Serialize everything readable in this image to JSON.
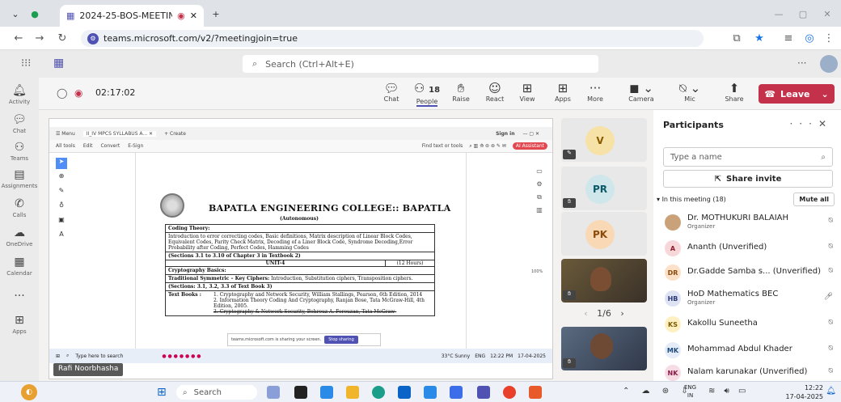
{
  "browser": {
    "tab_title": "2024-25-BOS-MEETING ON",
    "url": "teams.microsoft.com/v2/?meetingjoin=true"
  },
  "teams": {
    "search_placeholder": "Search (Ctrl+Alt+E)",
    "rail": [
      {
        "label": "Activity",
        "icon": "bell-icon"
      },
      {
        "label": "Chat",
        "icon": "chat-icon"
      },
      {
        "label": "Teams",
        "icon": "teams-icon"
      },
      {
        "label": "Assignments",
        "icon": "assignments-icon"
      },
      {
        "label": "Calls",
        "icon": "phone-icon"
      },
      {
        "label": "OneDrive",
        "icon": "cloud-icon"
      },
      {
        "label": "Calendar",
        "icon": "calendar-icon"
      },
      {
        "label": "Apps",
        "icon": "apps-icon"
      }
    ]
  },
  "meeting": {
    "timer": "02:17:02",
    "people_count": "18",
    "toolbar": [
      "Chat",
      "People",
      "Raise",
      "React",
      "View",
      "Apps",
      "More",
      "Camera",
      "Mic",
      "Share"
    ],
    "leave_label": "Leave",
    "presenter_name": "Rafi Noorbhasha",
    "pager": "1/6"
  },
  "shared_screen": {
    "tab_label": "II_IV MPCS SYLLABUS A...",
    "create_label": "+ Create",
    "pdf_menu": [
      "All tools",
      "Edit",
      "Convert",
      "E-Sign"
    ],
    "find_label": "Find text or tools",
    "sign_in": "Sign in",
    "ai_assistant": "AI Assistant",
    "college": "BAPATLA ENGINEERING COLLEGE:: BAPATLA",
    "autonomous": "(Autonomous)",
    "coding_theory": "Coding Theory:",
    "coding_text": "Introduction to error correcting codes, Basic definitions, Matrix description of Linear Block Codes, Equivalent Codes, Parity Check Matrix, Decoding of a Liner Block Code, Syndrome Decoding,Error Probability after Coding, Perfect Codes, Hamming Codes",
    "sections1": "(Sections 3.1 to 3.10 of Chapter 3 in Textbook 2)",
    "unit4": "UNIT-4",
    "hours": "(12 Hours)",
    "crypto_basics": "Cryptography Basics:",
    "traditional": "Traditional Symmetric – Key Ciphers:",
    "traditional_text": " Introduction, Substitution ciphers, Transposition ciphers.",
    "sections2": "(Sections: 3.1, 3.2, 3.3 of Text Book 3)",
    "textbooks_label": "Text Books :",
    "book1": "1.  Cryptography and Network Security, William Stallings, Pearson, 6th Edition, 2014",
    "book2": "2.  Information Theory Coding And Cryptography, Ranjan Bose, Tata McGraw-Hill, 4th Edition, 2005.",
    "book3": "3.  Cryptography & Network Security, Behrouz A. Forouzan, Tata McGraw-",
    "sharing_notice": "teams.microsoft.com is sharing your screen.",
    "stop_sharing": "Stop sharing",
    "inner_search": "Type here to search",
    "inner_weather": "33°C  Sunny",
    "inner_time": "12:22 PM",
    "inner_date": "17-04-2025",
    "inner_lang": "ENG",
    "zoom": "100%"
  },
  "tiles": [
    {
      "initials": "V",
      "color": "#f6e1a6",
      "text_color": "#8a5a00"
    },
    {
      "initials": "PR",
      "color": "#cfe6ea",
      "text_color": "#0b5a6a"
    },
    {
      "initials": "PK",
      "color": "#f9d9b5",
      "text_color": "#8a4b0b"
    }
  ],
  "participants": {
    "title": "Participants",
    "search_placeholder": "Type a name",
    "share_invite": "Share invite",
    "in_meeting": "In this meeting (18)",
    "mute_all": "Mute all",
    "list": [
      {
        "name": "Dr. MOTHUKURI BALAIAH",
        "role": "Organizer",
        "initials": "",
        "color": "#c9a27a",
        "mic": "mic-off-icon"
      },
      {
        "name": "Ananth (Unverified)",
        "role": "",
        "initials": "A",
        "color": "#f8d7da",
        "mic": "mic-off-icon"
      },
      {
        "name": "Dr.Gadde Samba s... (Unverified)",
        "role": "",
        "initials": "DR",
        "color": "#fde0c8",
        "mic": "mic-off-icon"
      },
      {
        "name": "HoD Mathematics BEC",
        "role": "Organizer",
        "initials": "HB",
        "color": "#dde3f3",
        "mic": "mic-on-icon"
      },
      {
        "name": "Kakollu Suneetha",
        "role": "",
        "initials": "KS",
        "color": "#fff0c2",
        "mic": "mic-off-icon"
      },
      {
        "name": "Mohammad Abdul Khader",
        "role": "",
        "initials": "MK",
        "color": "#e3ecf7",
        "mic": "mic-off-icon"
      },
      {
        "name": "Nalam karunakar (Unverified)",
        "role": "",
        "initials": "NK",
        "color": "#f7dbe5",
        "mic": "mic-off-icon"
      }
    ]
  },
  "taskbar": {
    "search": "Search",
    "lang": "ENG",
    "lang2": "IN",
    "time": "12:22",
    "date": "17-04-2025"
  }
}
